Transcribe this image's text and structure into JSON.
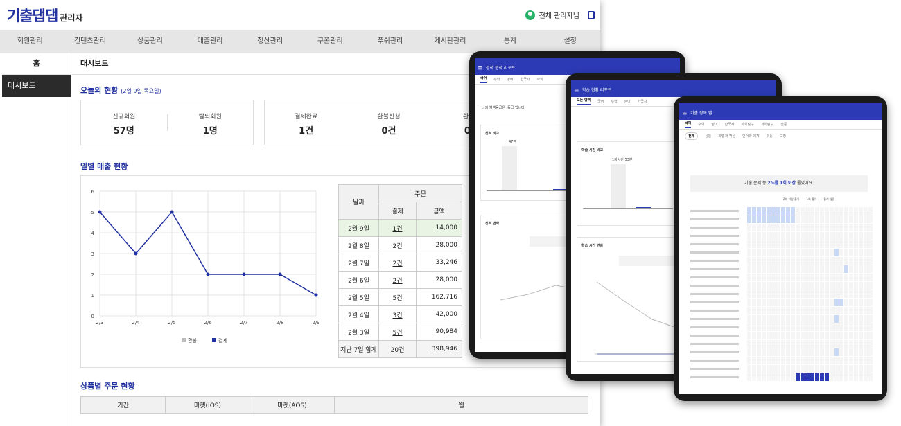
{
  "brand": {
    "logo": "기출댑댑",
    "sub": "관리자"
  },
  "user": {
    "name": "전체 관리자님"
  },
  "gnb": [
    "회원관리",
    "컨텐츠관리",
    "상품관리",
    "매출관리",
    "정산관리",
    "쿠폰관리",
    "푸쉬관리",
    "게시판관리",
    "통계",
    "설정"
  ],
  "side": {
    "home": "홈",
    "dashboard": "대시보드"
  },
  "main": {
    "title": "대시보드",
    "today_title": "오늘의 현황",
    "today_date": "(2일 9일 목요일)",
    "stats": [
      {
        "label": "신규회원",
        "value": "57명"
      },
      {
        "label": "탈퇴회원",
        "value": "1명"
      },
      {
        "label": "결제완료",
        "value": "1건"
      },
      {
        "label": "환불신청",
        "value": "0건"
      },
      {
        "label": "환불완",
        "value": "0건"
      }
    ],
    "daily_title": "일별 매출 현황",
    "product_title": "상품별 주문 현황"
  },
  "chart_data": {
    "type": "line",
    "x": [
      "2/3",
      "2/4",
      "2/5",
      "2/6",
      "2/7",
      "2/8",
      "2/9"
    ],
    "series": [
      {
        "name": "결제",
        "values": [
          5,
          3,
          5,
          2,
          2,
          2,
          1
        ],
        "color": "#2231a0"
      },
      {
        "name": "환불",
        "values": [
          0,
          0,
          0,
          0,
          0,
          0,
          0
        ],
        "color": "#aaaaaa"
      }
    ],
    "yticks": [
      "0",
      "1",
      "2",
      "3",
      "4",
      "5",
      "6"
    ],
    "ylim": [
      0,
      6
    ],
    "legend": [
      "환불",
      "결제"
    ]
  },
  "sales_table": {
    "h_date": "날짜",
    "h_order": "주문",
    "h_pay": "결제",
    "h_amount": "금액",
    "rows": [
      {
        "date": "2월 9일",
        "pay": "1건",
        "amount": "14,000"
      },
      {
        "date": "2월 8일",
        "pay": "2건",
        "amount": "28,000"
      },
      {
        "date": "2월 7일",
        "pay": "2건",
        "amount": "33,246"
      },
      {
        "date": "2월 6일",
        "pay": "2건",
        "amount": "28,000"
      },
      {
        "date": "2월 5일",
        "pay": "5건",
        "amount": "162,716"
      },
      {
        "date": "2월 4일",
        "pay": "3건",
        "amount": "42,000"
      },
      {
        "date": "2월 3일",
        "pay": "5건",
        "amount": "90,984"
      }
    ],
    "sum": {
      "label": "지난 7일 합계",
      "pay": "20건",
      "amount": "398,946"
    }
  },
  "product_table": {
    "period": "기간",
    "ios": "마켓(IOS)",
    "aos": "마켓(AOS)",
    "web": "웹"
  },
  "tablets": {
    "t1": {
      "title": "성적 분석 리포트",
      "tabs": [
        "국어",
        "수학",
        "영어",
        "한국사",
        "사회"
      ],
      "grade_text": "나의 쌤쌤등급은 -등급 입니다.",
      "compare": "성적 비교",
      "change": "성적 변화",
      "note": "일주일 동안 0",
      "val": "47점"
    },
    "t2": {
      "title": "학습 현황 리포트",
      "tabs": [
        "모든 영역",
        "국어",
        "수학",
        "영어",
        "한국사"
      ],
      "compare": "학습 시간 비교",
      "change": "학습 시간 변화",
      "note": "일주일 동안 02",
      "val": "1자시간 53분"
    },
    "t3": {
      "title": "기출 정복 맵",
      "tabs": [
        "국어",
        "수학",
        "영어",
        "한국사",
        "사회탐구",
        "과학탐구",
        "전문"
      ],
      "subtabs": [
        "전체",
        "공통",
        "화법과 작문",
        "언어와 매체",
        "수능",
        "모평"
      ],
      "banner_a": "기출 문제 중",
      "banner_b": "2%를 1회 이상",
      "banner_c": "풀었어요.",
      "legend": [
        "2회 이상 풀이",
        "1회 풀이",
        "풀지 않음"
      ]
    }
  },
  "colors": {
    "accent": "#2231a0",
    "tablet_bar": "#2c3bb5"
  }
}
